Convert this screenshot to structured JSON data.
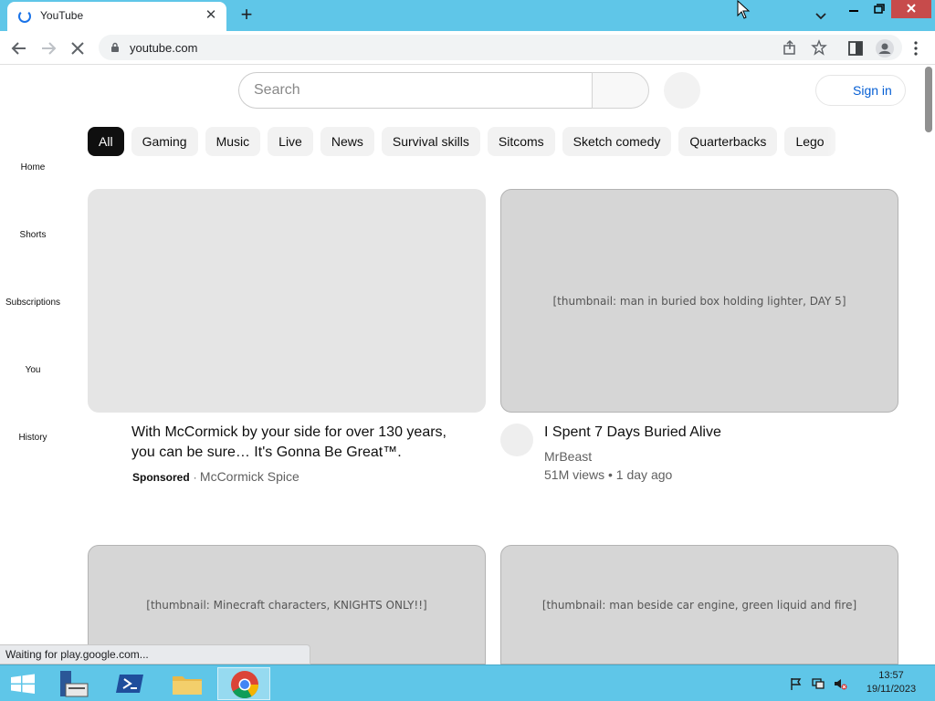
{
  "browser": {
    "tab_title": "YouTube",
    "url": "youtube.com",
    "status_text": "Waiting for play.google.com..."
  },
  "header": {
    "search_placeholder": "Search",
    "signin_label": "Sign in"
  },
  "chips": [
    "All",
    "Gaming",
    "Music",
    "Live",
    "News",
    "Survival skills",
    "Sitcoms",
    "Sketch comedy",
    "Quarterbacks",
    "Lego"
  ],
  "guide": [
    {
      "label": "Home"
    },
    {
      "label": "Shorts"
    },
    {
      "label": "Subscriptions"
    },
    {
      "label": "You"
    },
    {
      "label": "History"
    }
  ],
  "videos": [
    {
      "title_line1": "With McCormick by your side for over 130 years,",
      "title_line2": "you can be sure… It's Gonna Be Great™.",
      "sponsored_label": "Sponsored",
      "channel": "McCormick Spice"
    },
    {
      "title": "I Spent 7 Days Buried Alive",
      "channel": "MrBeast",
      "stats": "51M views • 1 day ago",
      "thumb_label": "[thumbnail: man in buried box holding lighter, DAY 5]"
    },
    {
      "thumb_label": "[thumbnail: Minecraft characters, KNIGHTS ONLY!!]"
    },
    {
      "thumb_label": "[thumbnail: man beside car engine, green liquid and fire]"
    }
  ],
  "taskbar": {
    "time": "13:57",
    "date": "19/11/2023"
  },
  "colors": {
    "chrome_frame": "#5fc6e8",
    "link_blue": "#065fd4",
    "chip_active": "#0f0f0f"
  }
}
